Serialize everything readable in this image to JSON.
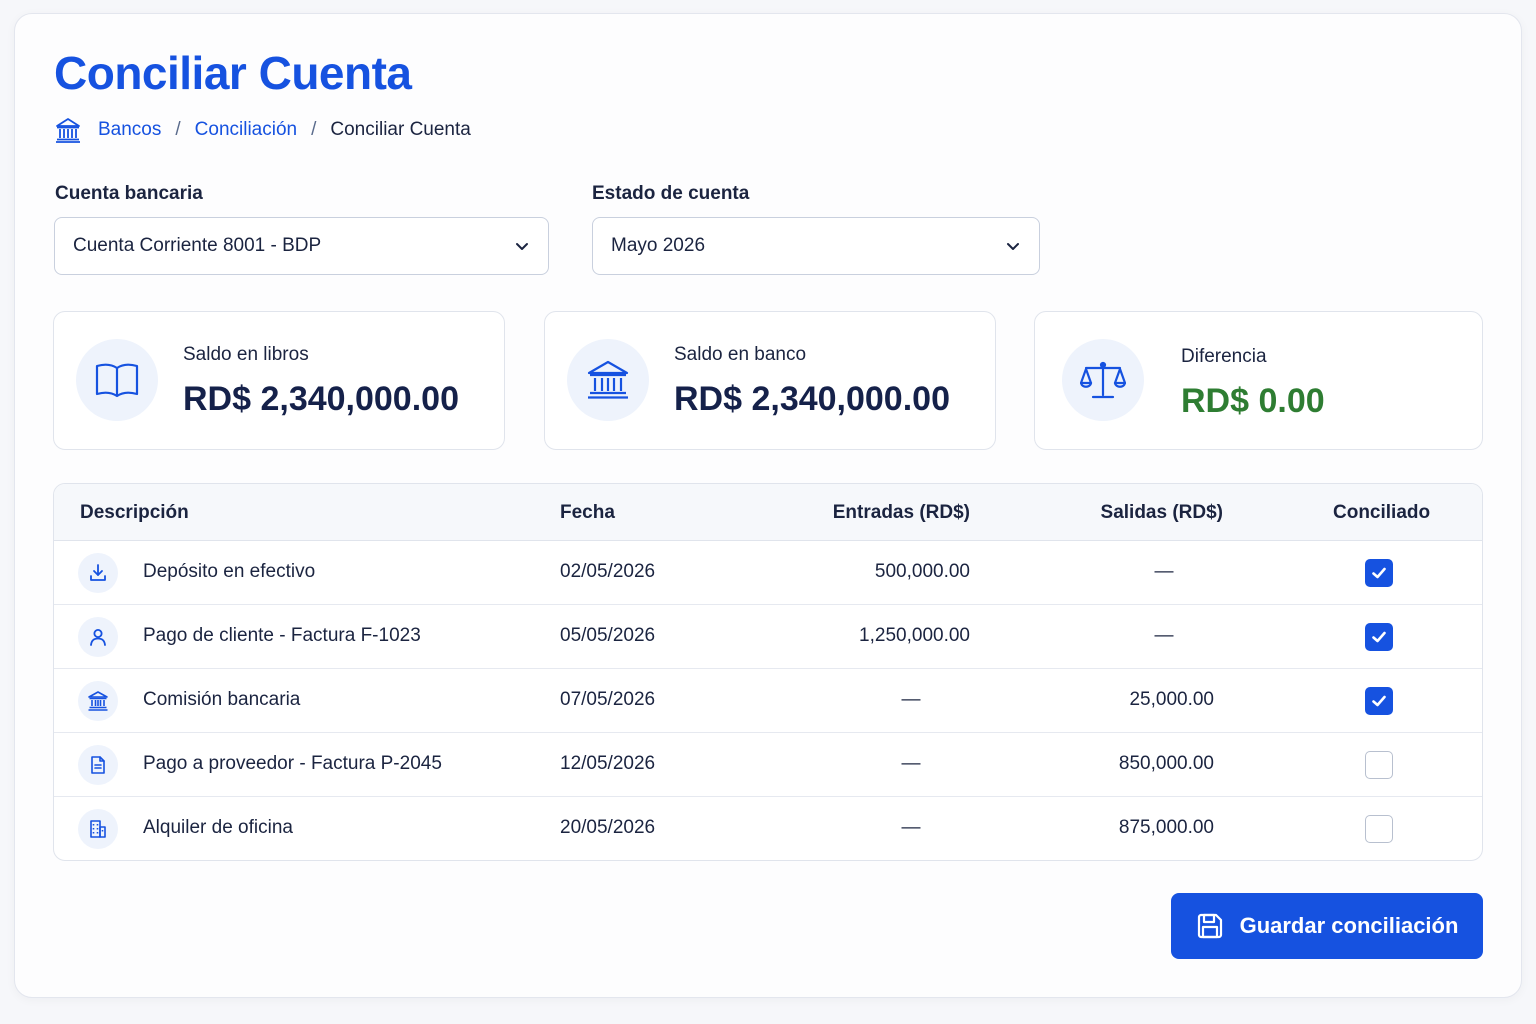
{
  "page": {
    "title": "Conciliar Cuenta"
  },
  "breadcrumb": {
    "icon": "bank-icon",
    "items": [
      "Bancos",
      "Conciliación",
      "Conciliar Cuenta"
    ],
    "separator": "/"
  },
  "filters": {
    "account": {
      "label": "Cuenta bancaria",
      "value": "Cuenta Corriente 8001 - BDP"
    },
    "statement": {
      "label": "Estado de cuenta",
      "value": "Mayo 2026"
    }
  },
  "summary": [
    {
      "icon": "book-icon",
      "label": "Saldo en libros",
      "value": "RD$ 2,340,000.00"
    },
    {
      "icon": "bank-icon",
      "label": "Saldo en banco",
      "value": "RD$ 2,340,000.00"
    },
    {
      "icon": "scale-icon",
      "label": "Diferencia",
      "value": "RD$ 0.00",
      "value_color": "#2e7d32"
    }
  ],
  "table": {
    "headers": [
      "Descripción",
      "Fecha",
      "Entradas (RD$)",
      "Salidas (RD$)",
      "Conciliado"
    ],
    "rows": [
      {
        "icon": "download-icon",
        "description": "Depósito en efectivo",
        "date": "02/05/2026",
        "in": "500,000.00",
        "out": "—",
        "reconciled": true
      },
      {
        "icon": "user-icon",
        "description": "Pago de cliente - Factura F-1023",
        "date": "05/05/2026",
        "in": "1,250,000.00",
        "out": "—",
        "reconciled": true
      },
      {
        "icon": "bank-icon",
        "description": "Comisión bancaria",
        "date": "07/05/2026",
        "in": "—",
        "out": "25,000.00",
        "reconciled": true
      },
      {
        "icon": "document-icon",
        "description": "Pago a proveedor - Factura P-2045",
        "date": "12/05/2026",
        "in": "—",
        "out": "850,000.00",
        "reconciled": false
      },
      {
        "icon": "building-icon",
        "description": "Alquiler de oficina",
        "date": "20/05/2026",
        "in": "—",
        "out": "875,000.00",
        "reconciled": false
      }
    ]
  },
  "actions": {
    "save_label": "Guardar conciliación",
    "save_icon": "save-icon"
  },
  "colors": {
    "accent": "#1652e0",
    "success": "#2e7d32"
  }
}
